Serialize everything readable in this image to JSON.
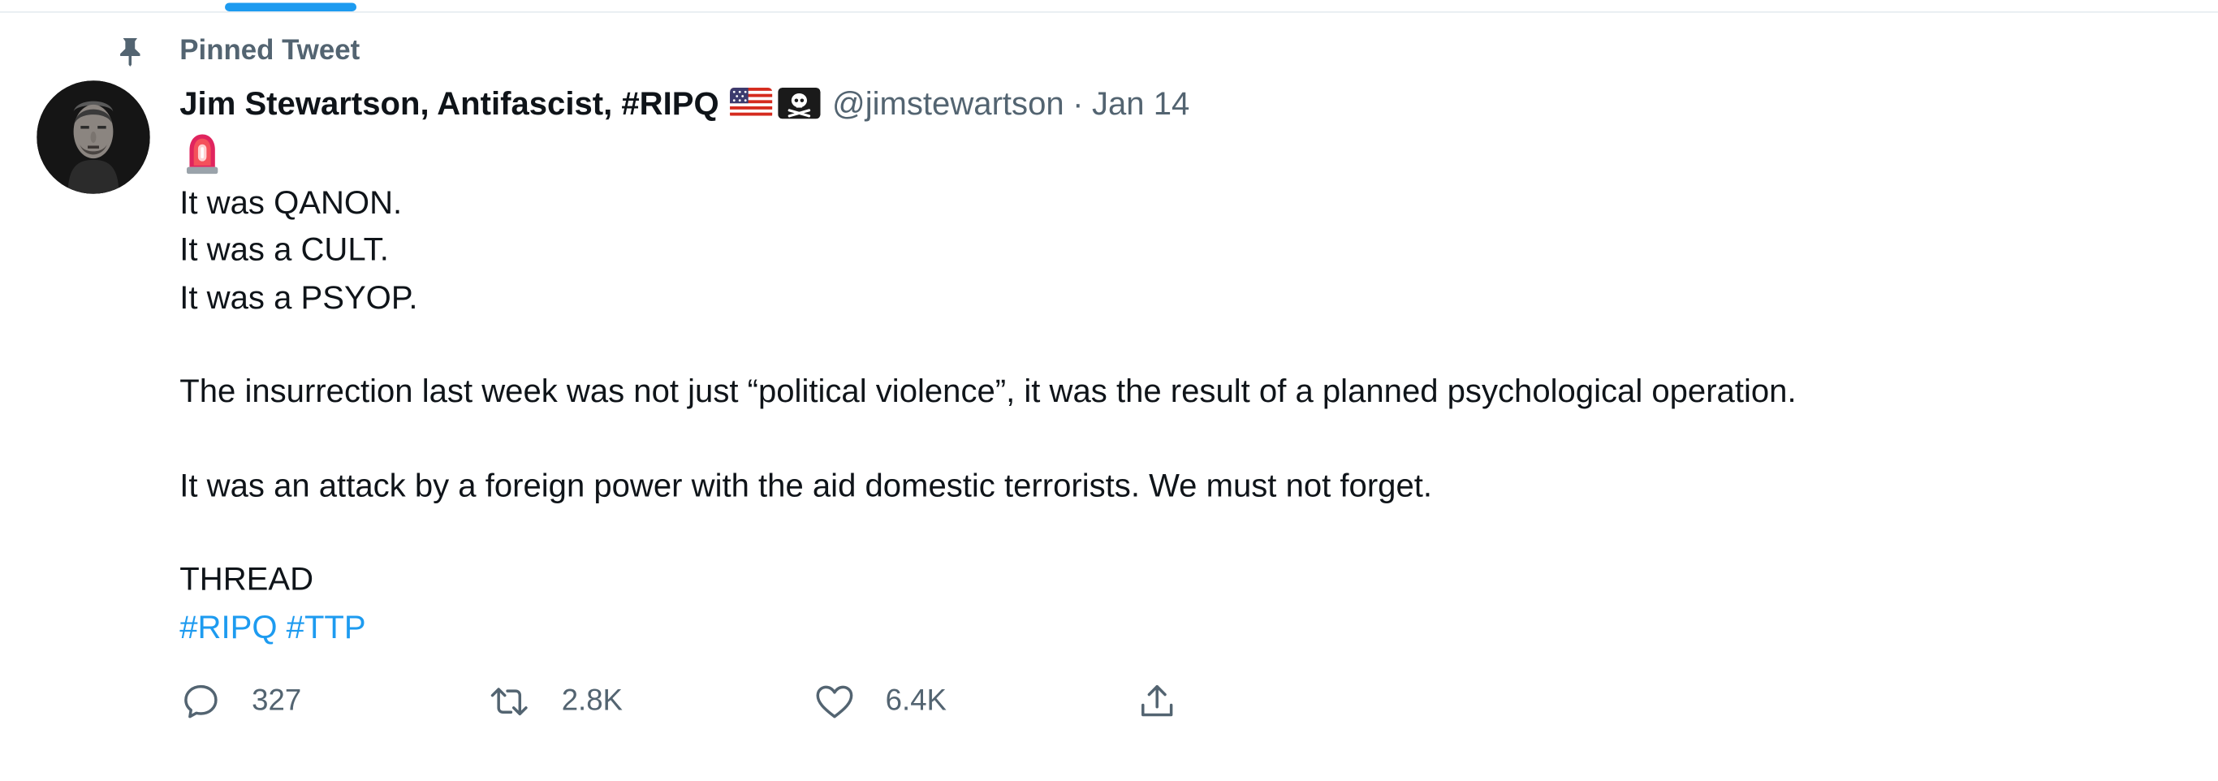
{
  "pinned": {
    "label": "Pinned Tweet",
    "icon": "pin-icon"
  },
  "tweet": {
    "author": {
      "display_name": "Jim Stewartson, Antifascist, #RIPQ",
      "handle": "@jimstewartson",
      "avatar_icon": "avatar",
      "emojis": [
        "us-flag-icon",
        "skull-crossbones-icon"
      ]
    },
    "separator": "·",
    "date": "Jan 14",
    "lead_emoji": "siren-icon",
    "body_lines": [
      "It was QANON.",
      "It was a CULT.",
      "It was a PSYOP.",
      "",
      "The insurrection last week was not just “political violence”, it was the result of a planned psychological operation.",
      "",
      "It was an attack by a foreign power with the aid domestic terrorists. We must not forget.",
      "",
      "THREAD"
    ],
    "hashtags": "#RIPQ #TTP"
  },
  "actions": {
    "reply": {
      "icon": "reply-icon",
      "count": "327"
    },
    "retweet": {
      "icon": "retweet-icon",
      "count": "2.8K"
    },
    "like": {
      "icon": "heart-icon",
      "count": "6.4K"
    },
    "share": {
      "icon": "share-icon"
    }
  },
  "colors": {
    "accent": "#1d9bf0",
    "secondary_text": "#536471",
    "primary_text": "#0f1419"
  }
}
